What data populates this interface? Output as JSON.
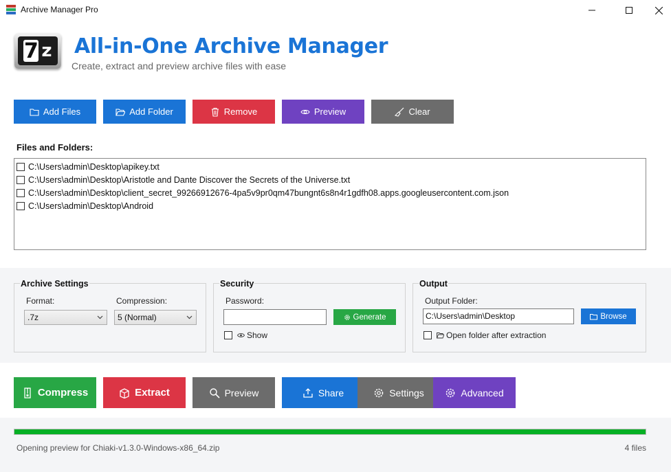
{
  "window": {
    "title": "Archive Manager Pro"
  },
  "header": {
    "logo_text": "7z",
    "headline": "All-in-One Archive Manager",
    "subheadline": "Create, extract and preview archive files with ease"
  },
  "toolbar": {
    "add_files": "Add Files",
    "add_folder": "Add Folder",
    "remove": "Remove",
    "preview": "Preview",
    "clear": "Clear"
  },
  "files_section": {
    "label": "Files and Folders:",
    "items": [
      {
        "path": "C:\\Users\\admin\\Desktop\\apikey.txt",
        "checked": false
      },
      {
        "path": "C:\\Users\\admin\\Desktop\\Aristotle and Dante Discover the Secrets of the Universe.txt",
        "checked": false
      },
      {
        "path": "C:\\Users\\admin\\Desktop\\client_secret_99266912676-4pa5v9pr0qm47bungnt6s8n4r1gdfh08.apps.googleusercontent.com.json",
        "checked": false
      },
      {
        "path": "C:\\Users\\admin\\Desktop\\Android",
        "checked": false
      }
    ]
  },
  "archive_settings": {
    "title": "Archive Settings",
    "format_label": "Format:",
    "format_value": ".7z",
    "compression_label": "Compression:",
    "compression_value": "5 (Normal)"
  },
  "security": {
    "title": "Security",
    "password_label": "Password:",
    "password_value": "",
    "generate_label": "Generate",
    "show_label": "Show",
    "show_checked": false
  },
  "output": {
    "title": "Output",
    "folder_label": "Output Folder:",
    "folder_value": "C:\\Users\\admin\\Desktop",
    "browse_label": "Browse",
    "open_after_label": "Open folder after extraction",
    "open_after_checked": false
  },
  "actions": {
    "compress": "Compress",
    "extract": "Extract",
    "preview": "Preview",
    "share": "Share",
    "settings": "Settings",
    "advanced": "Advanced"
  },
  "status": {
    "progress_percent": 100,
    "message": "Opening preview for Chiaki-v1.3.0-Windows-x86_64.zip",
    "file_count": "4 files"
  },
  "colors": {
    "primary": "#1a74d6",
    "danger": "#dc3545",
    "purple": "#6f42c1",
    "gray": "#6c6c6c",
    "success": "#28a745",
    "progress": "#06b025"
  }
}
